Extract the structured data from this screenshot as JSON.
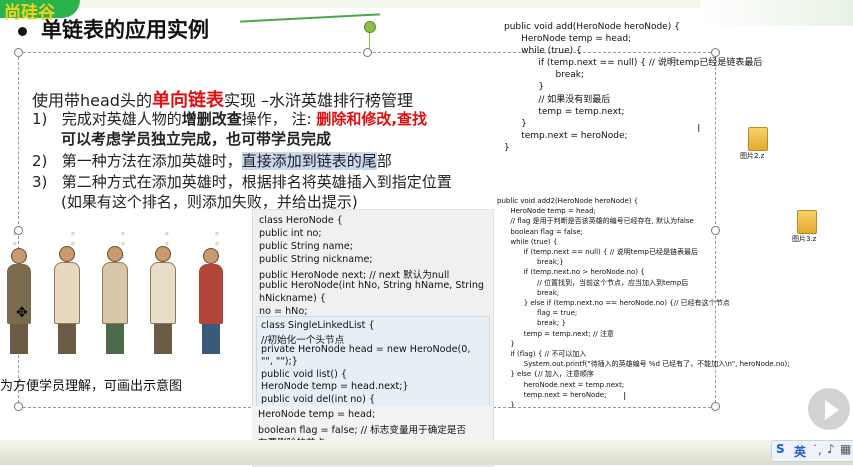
{
  "header": {
    "logo_text": "尚硅谷",
    "title": "单链表的应用实例"
  },
  "intro": {
    "line_prefix": "使用带head头的",
    "line_red": "单向链表",
    "line_suffix": "实现 –水浒英雄排行榜管理"
  },
  "steps": [
    {
      "num": "1)",
      "text_a": "完成对英雄人物的",
      "text_b": "增删改查",
      "text_c": "操作， 注: ",
      "text_red": "删除和修改,查找",
      "line2": "可以考虑学员独立完成，也可带学员完成"
    },
    {
      "num": "2)",
      "text_a": "第一种方法在添加英雄时，",
      "text_hl": "直接添加到链表的尾",
      "text_c": "部"
    },
    {
      "num": "3)",
      "text_a": "第二种方式在添加英雄时，根据排名将英雄插入到指定位置",
      "line2": "(如果有这个排名，则添加失败，并给出提示)"
    }
  ],
  "caption": "为方便学员理解，可画出示意图",
  "code_add": "public void add(HeroNode heroNode) {\n      HeroNode temp = head;\n      while (true) {\n            if (temp.next == null) { // 说明temp已经是链表最后\n                  break;\n            }\n            // 如果没有到最后\n            temp = temp.next;\n      }\n      temp.next = heroNode;\n}",
  "code_add2": "public void add2(HeroNode heroNode) {\n      HeroNode temp = head;\n      // flag 是用于判断是否该英雄的编号已经存在, 默认为false\n      boolean flag = false;\n      while (true) {\n            if (temp.next == null) { // 说明temp已经是链表最后\n                  break;}\n            if (temp.next.no > heroNode.no) {\n                  // 位置找到，当前这个节点，应当加入到temp后\n                  break;\n            } else if (temp.next.no == heroNode.no) {// 已经有这个节点\n                  flag = true;\n                  break; }\n            temp = temp.next; // 注意\n      }\n      if (flag) { // 不可以加入\n            System.out.printf(\"待插入的英雄编号 %d 已经有了，不能加入\\n\", heroNode.no);\n      } else {// 加入，注意顺序\n            heroNode.next = temp.next;\n            temp.next = heroNode;\n      }",
  "code_heronode": [
    "class HeroNode  {",
    "public int no;",
    "public String name;",
    "public String nickname;",
    "public HeroNode  next; // next 默认为null",
    "public HeroNode(int  hNo, String hName,  String",
    "hNickname)  {",
    "no = hNo;"
  ],
  "code_list": [
    "class SingleLinkedList  {",
    "  //初始化一个头节点",
    "  private HeroNode  head = new HeroNode(0,",
    "\"\", \"\");}",
    " public void list() {",
    "    HeroNode  temp = head.next;}",
    " public void del(int no) {"
  ],
  "code_del": [
    "HeroNode temp = head;",
    "boolean flag = false; // 标志变量用于确定是否",
    "有要删除的节点"
  ],
  "files": [
    {
      "label": "图片2.z"
    },
    {
      "label": "图片3.z"
    }
  ],
  "ime": {
    "label": "英"
  },
  "colors": {
    "accent_red": "#e01010",
    "logo_green": "#28b44a",
    "logo_yellow": "#f2d21c",
    "highlight": "#c9d8ef"
  }
}
